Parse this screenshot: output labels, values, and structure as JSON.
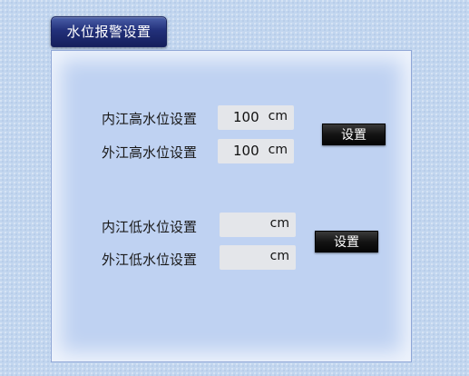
{
  "title": "水位报警设置",
  "high_water": {
    "inner": {
      "label": "内江高水位设置",
      "value": "100",
      "unit": "cm"
    },
    "outer": {
      "label": "外江高水位设置",
      "value": "100",
      "unit": "cm"
    },
    "set_button_label": "设置"
  },
  "low_water": {
    "inner": {
      "label": "内江低水位设置",
      "value": "",
      "unit": "cm"
    },
    "outer": {
      "label": "外江低水位设置",
      "value": "",
      "unit": "cm"
    },
    "set_button_label": "设置"
  }
}
